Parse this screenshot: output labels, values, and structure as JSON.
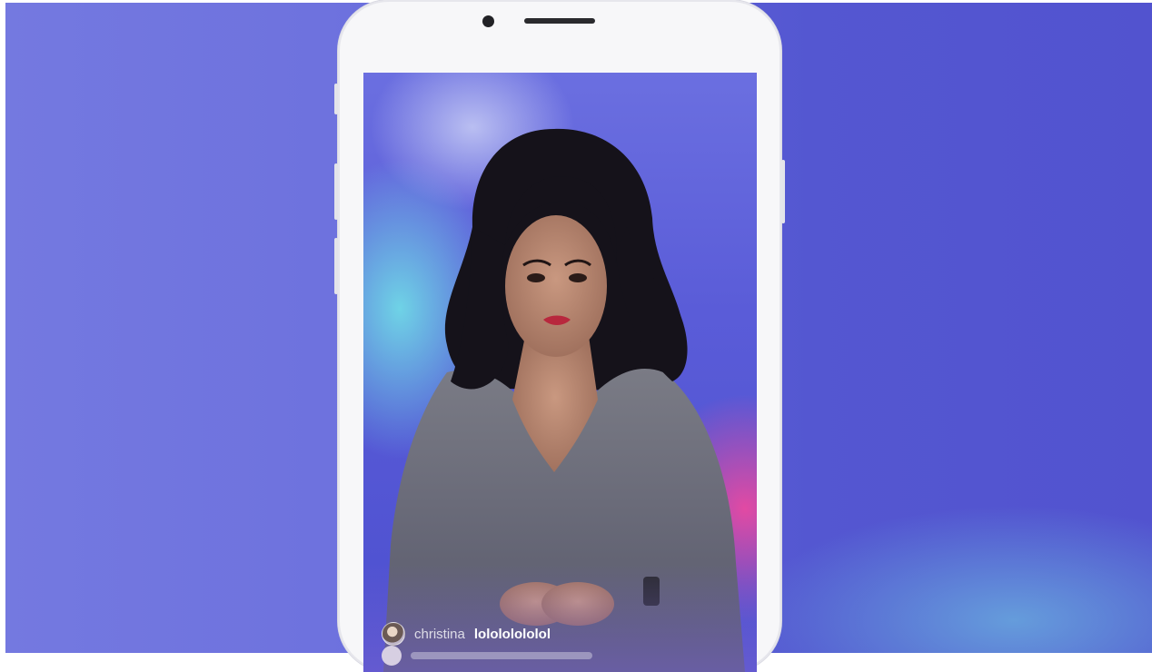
{
  "screen": {
    "comments": [
      {
        "user": "christina",
        "text": "lolololololol"
      }
    ]
  },
  "colors": {
    "background": "#6e72de",
    "screen_accent_cyan": "#6fd3e6",
    "screen_accent_pink": "#e24aa3",
    "phone_body": "#f7f7f9"
  },
  "icons": {
    "camera": "front-camera-icon",
    "speaker": "earpiece-speaker-icon"
  }
}
